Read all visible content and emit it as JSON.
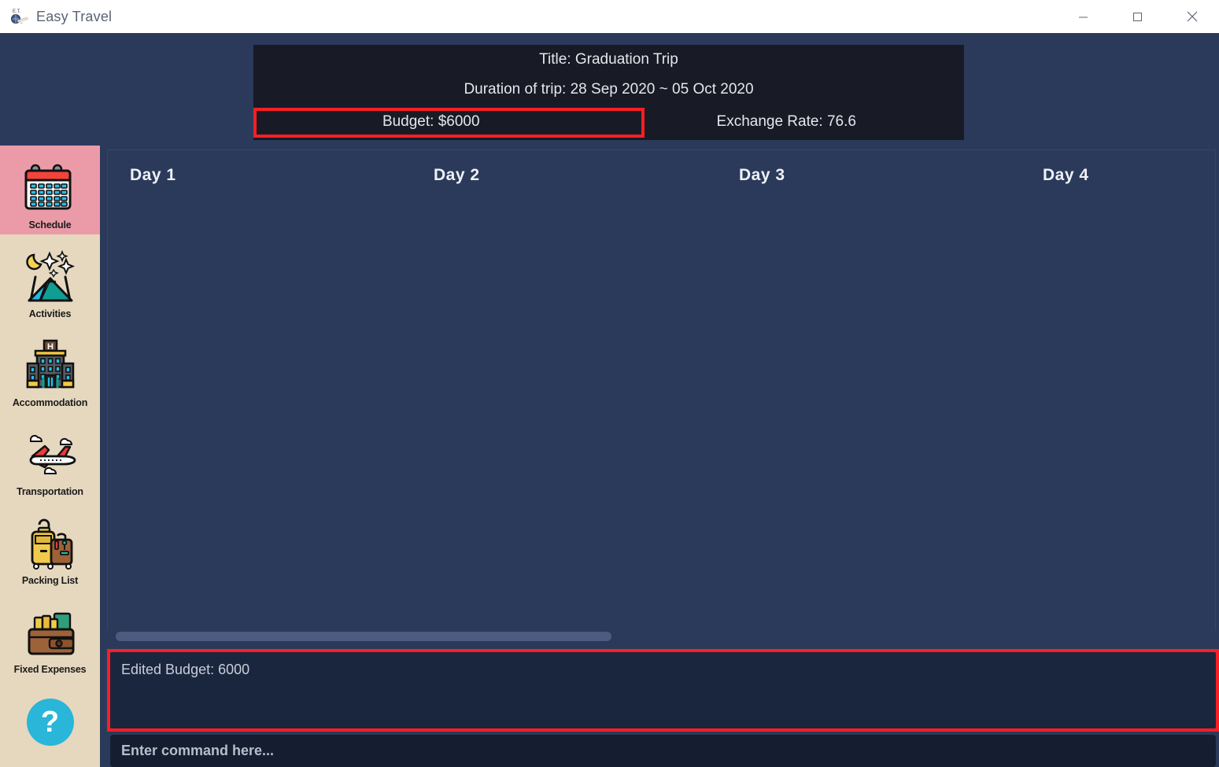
{
  "window": {
    "title": "Easy Travel",
    "app_icon": "globe-plane-icon",
    "controls": {
      "minimize": "—",
      "maximize": "□",
      "close": "✕"
    }
  },
  "header": {
    "title_line": "Title: Graduation Trip",
    "duration_line": "Duration of trip: 28 Sep 2020 ~ 05 Oct 2020",
    "budget": "Budget: $6000",
    "exchange_rate": "Exchange Rate: 76.6"
  },
  "sidebar": {
    "items": [
      {
        "label": "Schedule",
        "icon": "calendar-icon",
        "active": true
      },
      {
        "label": "Activities",
        "icon": "tent-night-icon",
        "active": false
      },
      {
        "label": "Accommodation",
        "icon": "hotel-icon",
        "active": false
      },
      {
        "label": "Transportation",
        "icon": "airplane-icon",
        "active": false
      },
      {
        "label": "Packing List",
        "icon": "luggage-icon",
        "active": false
      },
      {
        "label": "Fixed Expenses",
        "icon": "wallet-money-icon",
        "active": false
      }
    ],
    "help_label": "?"
  },
  "schedule": {
    "days": [
      {
        "label": "Day 1"
      },
      {
        "label": "Day 2"
      },
      {
        "label": "Day 3"
      },
      {
        "label": "Day 4"
      }
    ]
  },
  "console": {
    "output": "Edited Budget: 6000",
    "command_placeholder": "Enter command here..."
  },
  "colors": {
    "window_bg": "#2b3a5a",
    "header_panel_bg": "#181a26",
    "sidebar_bg": "#e5d8bf",
    "sidebar_active_bg": "#eb9ba8",
    "output_bg": "#1a263d",
    "command_bg": "#151e30",
    "highlight_red": "#fb1e24",
    "help_cyan": "#29b6d8",
    "scrollbar_thumb": "#4b5c80"
  }
}
